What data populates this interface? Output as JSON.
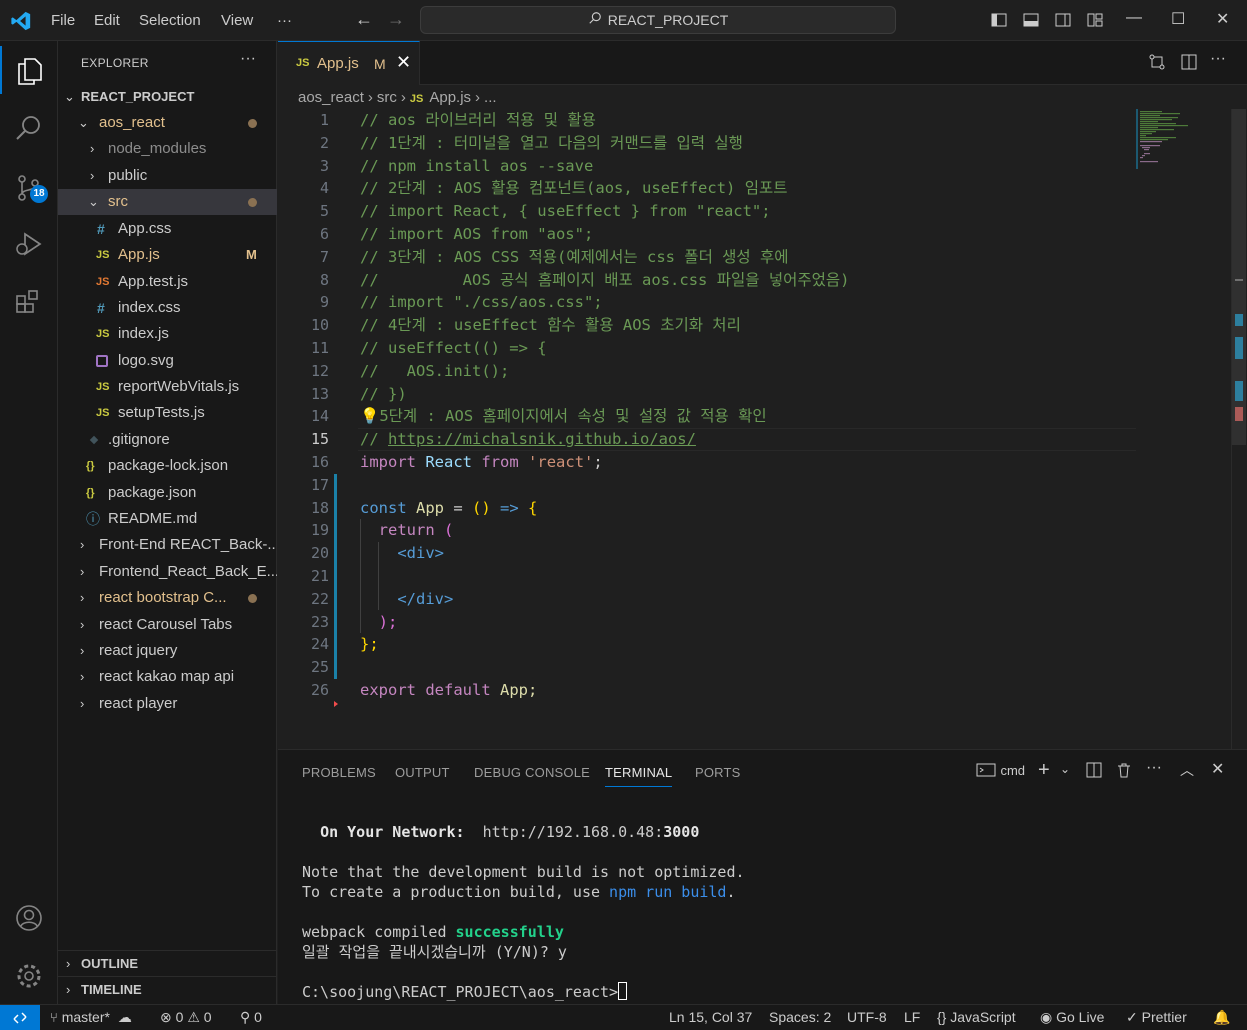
{
  "menu": [
    "File",
    "Edit",
    "Selection",
    "View",
    "···"
  ],
  "search": {
    "text": "REACT_PROJECT"
  },
  "activity_bar": {
    "scm_badge": "18"
  },
  "sidebar": {
    "header": "EXPLORER",
    "more": "···",
    "root": "REACT_PROJECT",
    "items": [
      {
        "label": "aos_react"
      },
      {
        "label": "node_modules"
      },
      {
        "label": "public"
      },
      {
        "label": "src"
      },
      {
        "label": "App.css",
        "icon": "#"
      },
      {
        "label": "App.js",
        "icon": "JS",
        "status": "M"
      },
      {
        "label": "App.test.js",
        "icon": "JS"
      },
      {
        "label": "index.css",
        "icon": "#"
      },
      {
        "label": "index.js",
        "icon": "JS"
      },
      {
        "label": "logo.svg",
        "icon": "svg"
      },
      {
        "label": "reportWebVitals.js",
        "icon": "JS"
      },
      {
        "label": "setupTests.js",
        "icon": "JS"
      },
      {
        "label": ".gitignore",
        "icon": "git"
      },
      {
        "label": "package-lock.json",
        "icon": "{}"
      },
      {
        "label": "package.json",
        "icon": "{}"
      },
      {
        "label": "README.md",
        "icon": "ⓘ"
      },
      {
        "label": "Front-End REACT_Back-..."
      },
      {
        "label": "Frontend_React_Back_E..."
      },
      {
        "label": "react bootstrap C..."
      },
      {
        "label": "react Carousel Tabs"
      },
      {
        "label": "react jquery"
      },
      {
        "label": "react kakao map api"
      },
      {
        "label": "react player"
      }
    ],
    "outline": "OUTLINE",
    "timeline": "TIMELINE"
  },
  "tab": {
    "icon": "JS",
    "name": "App.js",
    "status": "M",
    "close": "✕"
  },
  "breadcrumb": {
    "folder1": "aos_react",
    "folder2": "src",
    "file": "App.js",
    "more": "..."
  },
  "editor": {
    "line_numbers": [
      "1",
      "2",
      "3",
      "4",
      "5",
      "6",
      "7",
      "8",
      "9",
      "10",
      "11",
      "12",
      "13",
      "14",
      "15",
      "16",
      "17",
      "18",
      "19",
      "20",
      "21",
      "22",
      "23",
      "24",
      "25",
      "26"
    ],
    "comments": [
      "// aos 라이브러리 적용 및 활용",
      "// 1단계 : 터미널을 열고 다음의 커맨드를 입력 실행",
      "// npm install aos --save",
      "// 2단계 : AOS 활용 컴포넌트(aos, useEffect) 임포트",
      "// import React, { useEffect } from \"react\";",
      "// import AOS from \"aos\";",
      "// 3단계 : AOS CSS 적용(예제에서는 css 폴더 생성 후에",
      "//         AOS 공식 홈페이지 배포 aos.css 파일을 넣어주었음)",
      "// import \"./css/aos.css\";",
      "// 4단계 : useEffect 함수 활용 AOS 초기화 처리",
      "// useEffect(() => {",
      "//   AOS.init();",
      "// })",
      "5단계 : AOS 홈페이지에서 속성 및 설정 값 적용 확인",
      "// ",
      "https://michalsnik.github.io/aos/"
    ],
    "code": {
      "import_kw": "import",
      "react_id": "React",
      "from_kw": "from",
      "react_str": "'react'",
      "semi": ";",
      "const_kw": "const",
      "app_id": "App",
      "eq": " = ",
      "parens": "()",
      "arrow": " => ",
      "brace_open": "{",
      "return_kw": "return",
      "paren_open": " (",
      "div_open": "<div>",
      "div_close": "</div>",
      "paren_close": ");",
      "brace_close": "};",
      "export_kw": "export",
      "default_kw": "default",
      "app_export": "App;"
    }
  },
  "panel": {
    "tabs": [
      "PROBLEMS",
      "OUTPUT",
      "DEBUG CONSOLE",
      "TERMINAL",
      "PORTS"
    ],
    "active_tab": "TERMINAL",
    "shell": "cmd",
    "terminal": {
      "network_label": "On Your Network:",
      "network_url_prefix": "http://192.168.0.48:",
      "network_port": "3000",
      "note_line": "Note that the development build is not optimized.",
      "create_prefix": "To create a production build, use ",
      "create_cmd": "npm run build",
      "create_suffix": ".",
      "webpack_prefix": "webpack compiled ",
      "webpack_status": "successfully",
      "batch_prompt": "일괄 작업을 끝내시겠습니까 (Y/N)? y",
      "prompt": "C:\\soojung\\REACT_PROJECT\\aos_react>"
    }
  },
  "statusbar": {
    "branch": "master*",
    "errors": "0",
    "warnings": "0",
    "ports": "0",
    "cursor": "Ln 15, Col 37",
    "spaces": "Spaces: 2",
    "encoding": "UTF-8",
    "eol": "LF",
    "language": "JavaScript",
    "golive": "Go Live",
    "prettier": "Prettier"
  },
  "colors": {
    "accent": "#0078d4",
    "comment": "#6a9955",
    "keyword": "#c586c0",
    "storage": "#569cd6",
    "string": "#ce9178",
    "modified": "#e2c08d",
    "success": "#23d18b"
  }
}
